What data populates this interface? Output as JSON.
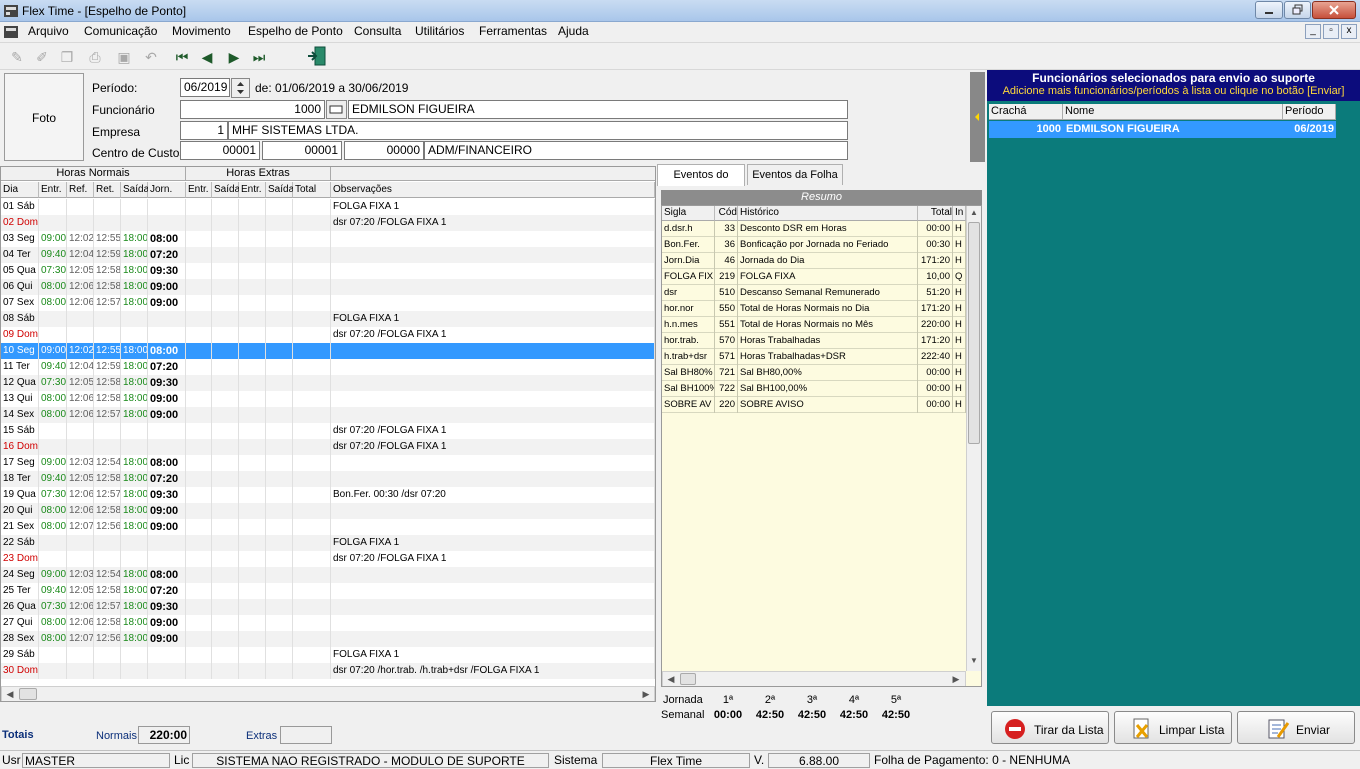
{
  "window": {
    "title": "Flex Time - [Espelho de Ponto]",
    "min": "0",
    "max": "1",
    "close": "r"
  },
  "menu": [
    "Arquivo",
    "Comunicação",
    "Movimento",
    "Espelho de Ponto",
    "Consulta",
    "Utilitários",
    "Ferramentas",
    "Ajuda"
  ],
  "header": {
    "foto": "Foto",
    "periodo_label": "Período:",
    "periodo_value": "06/2019",
    "periodo_range": "de: 01/06/2019 a 30/06/2019",
    "funcionario_label": "Funcionário",
    "funcionario_code": "1000",
    "funcionario_name": "EDMILSON FIGUEIRA",
    "empresa_label": "Empresa",
    "empresa_code": "1",
    "empresa_name": "MHF SISTEMAS LTDA.",
    "cc_label": "Centro de Custos",
    "cc1": "00001",
    "cc2": "00001",
    "cc3": "00000",
    "cc_name": "ADM/FINANCEIRO"
  },
  "grid": {
    "group_normais": "Horas Normais",
    "group_extras": "Horas Extras",
    "columns": [
      "Dia",
      "Entr.",
      "Ref.",
      "Ret.",
      "Saída",
      "Jorn.",
      "Entr.",
      "Saída",
      "Entr.",
      "Saída",
      "Total",
      "Observações"
    ],
    "rows": [
      {
        "dia": "01 Sáb",
        "e": "",
        "r": "",
        "t": "",
        "s": "",
        "j": "",
        "obs": "FOLGA FIXA 1",
        "dom": false
      },
      {
        "dia": "02 Dom",
        "e": "",
        "r": "",
        "t": "",
        "s": "",
        "j": "",
        "obs": "dsr     07:20 /FOLGA FIXA 1",
        "dom": true
      },
      {
        "dia": "03 Seg",
        "e": "09:00",
        "r": "12:02",
        "t": "12:55",
        "s": "18:00",
        "j": "08:00",
        "obs": "",
        "dom": false
      },
      {
        "dia": "04 Ter",
        "e": "09:40",
        "r": "12:04",
        "t": "12:59",
        "s": "18:00",
        "j": "07:20",
        "obs": "",
        "dom": false
      },
      {
        "dia": "05 Qua",
        "e": "07:30",
        "r": "12:05",
        "t": "12:58",
        "s": "18:00",
        "j": "09:30",
        "obs": "",
        "dom": false
      },
      {
        "dia": "06 Qui",
        "e": "08:00",
        "r": "12:06",
        "t": "12:58",
        "s": "18:00",
        "j": "09:00",
        "obs": "",
        "dom": false
      },
      {
        "dia": "07 Sex",
        "e": "08:00",
        "r": "12:06",
        "t": "12:57",
        "s": "18:00",
        "j": "09:00",
        "obs": "",
        "dom": false
      },
      {
        "dia": "08 Sáb",
        "e": "",
        "r": "",
        "t": "",
        "s": "",
        "j": "",
        "obs": "FOLGA FIXA 1",
        "dom": false
      },
      {
        "dia": "09 Dom",
        "e": "",
        "r": "",
        "t": "",
        "s": "",
        "j": "",
        "obs": "dsr     07:20 /FOLGA FIXA 1",
        "dom": true
      },
      {
        "dia": "10 Seg",
        "e": "09:00",
        "r": "12:02",
        "t": "12:55",
        "s": "18:00",
        "j": "08:00",
        "obs": "",
        "dom": false,
        "sel": true
      },
      {
        "dia": "11 Ter",
        "e": "09:40",
        "r": "12:04",
        "t": "12:59",
        "s": "18:00",
        "j": "07:20",
        "obs": "",
        "dom": false
      },
      {
        "dia": "12 Qua",
        "e": "07:30",
        "r": "12:05",
        "t": "12:58",
        "s": "18:00",
        "j": "09:30",
        "obs": "",
        "dom": false
      },
      {
        "dia": "13 Qui",
        "e": "08:00",
        "r": "12:06",
        "t": "12:58",
        "s": "18:00",
        "j": "09:00",
        "obs": "",
        "dom": false
      },
      {
        "dia": "14 Sex",
        "e": "08:00",
        "r": "12:06",
        "t": "12:57",
        "s": "18:00",
        "j": "09:00",
        "obs": "",
        "dom": false
      },
      {
        "dia": "15 Sáb",
        "e": "",
        "r": "",
        "t": "",
        "s": "",
        "j": "",
        "obs": "dsr     07:20 /FOLGA FIXA 1",
        "dom": false
      },
      {
        "dia": "16 Dom",
        "e": "",
        "r": "",
        "t": "",
        "s": "",
        "j": "",
        "obs": "dsr     07:20 /FOLGA FIXA 1",
        "dom": true
      },
      {
        "dia": "17 Seg",
        "e": "09:00",
        "r": "12:03",
        "t": "12:54",
        "s": "18:00",
        "j": "08:00",
        "obs": "",
        "dom": false
      },
      {
        "dia": "18 Ter",
        "e": "09:40",
        "r": "12:05",
        "t": "12:58",
        "s": "18:00",
        "j": "07:20",
        "obs": "",
        "dom": false
      },
      {
        "dia": "19 Qua",
        "e": "07:30",
        "r": "12:06",
        "t": "12:57",
        "s": "18:00",
        "j": "09:30",
        "obs": "Bon.Fer. 00:30 /dsr      07:20",
        "dom": false
      },
      {
        "dia": "20 Qui",
        "e": "08:00",
        "r": "12:06",
        "t": "12:58",
        "s": "18:00",
        "j": "09:00",
        "obs": "",
        "dom": false
      },
      {
        "dia": "21 Sex",
        "e": "08:00",
        "r": "12:07",
        "t": "12:56",
        "s": "18:00",
        "j": "09:00",
        "obs": "",
        "dom": false
      },
      {
        "dia": "22 Sáb",
        "e": "",
        "r": "",
        "t": "",
        "s": "",
        "j": "",
        "obs": "FOLGA FIXA 1",
        "dom": false
      },
      {
        "dia": "23 Dom",
        "e": "",
        "r": "",
        "t": "",
        "s": "",
        "j": "",
        "obs": "dsr     07:20 /FOLGA FIXA 1",
        "dom": true
      },
      {
        "dia": "24 Seg",
        "e": "09:00",
        "r": "12:03",
        "t": "12:54",
        "s": "18:00",
        "j": "08:00",
        "obs": "",
        "dom": false
      },
      {
        "dia": "25 Ter",
        "e": "09:40",
        "r": "12:05",
        "t": "12:58",
        "s": "18:00",
        "j": "07:20",
        "obs": "",
        "dom": false
      },
      {
        "dia": "26 Qua",
        "e": "07:30",
        "r": "12:06",
        "t": "12:57",
        "s": "18:00",
        "j": "09:30",
        "obs": "",
        "dom": false
      },
      {
        "dia": "27 Qui",
        "e": "08:00",
        "r": "12:06",
        "t": "12:58",
        "s": "18:00",
        "j": "09:00",
        "obs": "",
        "dom": false
      },
      {
        "dia": "28 Sex",
        "e": "08:00",
        "r": "12:07",
        "t": "12:56",
        "s": "18:00",
        "j": "09:00",
        "obs": "",
        "dom": false
      },
      {
        "dia": "29 Sáb",
        "e": "",
        "r": "",
        "t": "",
        "s": "",
        "j": "",
        "obs": "FOLGA FIXA 1",
        "dom": false
      },
      {
        "dia": "30 Dom",
        "e": "",
        "r": "",
        "t": "",
        "s": "",
        "j": "",
        "obs": "dsr     07:20 /hor.trab. /h.trab+dsr /FOLGA FIXA 1",
        "dom": true
      }
    ]
  },
  "tabs": [
    "Eventos do Ponto",
    "Eventos da Folha"
  ],
  "resumo": {
    "title": "Resumo",
    "columns": [
      "Sigla",
      "Cód",
      "Histórico",
      "Total",
      "In"
    ],
    "rows": [
      [
        "d.dsr.h",
        "33",
        "Desconto DSR em Horas",
        "00:00",
        "H"
      ],
      [
        "Bon.Fer.",
        "36",
        "Bonficação por Jornada no Feriado",
        "00:30",
        "H"
      ],
      [
        "Jorn.Dia",
        "46",
        "Jornada do Dia",
        "171:20",
        "H"
      ],
      [
        "FOLGA FIX",
        "219",
        "FOLGA FIXA",
        "10,00",
        "Q"
      ],
      [
        "dsr",
        "510",
        "Descanso Semanal Remunerado",
        "51:20",
        "H"
      ],
      [
        "hor.nor",
        "550",
        "Total de Horas Normais no Dia",
        "171:20",
        "H"
      ],
      [
        "h.n.mes",
        "551",
        "Total de Horas Normais no Mês",
        "220:00",
        "H"
      ],
      [
        "hor.trab.",
        "570",
        "Horas Trabalhadas",
        "171:20",
        "H"
      ],
      [
        "h.trab+dsr",
        "571",
        "Horas Trabalhadas+DSR",
        "222:40",
        "H"
      ],
      [
        "Sal BH80%",
        "721",
        "Sal BH80,00%",
        "00:00",
        "H"
      ],
      [
        "Sal BH100%",
        "722",
        "Sal BH100,00%",
        "00:00",
        "H"
      ],
      [
        "SOBRE AV",
        "220",
        "SOBRE AVISO",
        "00:00",
        "H"
      ]
    ]
  },
  "jornada": {
    "label": "Jornada",
    "semanal_label": "Semanal",
    "weeks": [
      "1ª",
      "2ª",
      "3ª",
      "4ª",
      "5ª"
    ],
    "values": [
      "00:00",
      "42:50",
      "42:50",
      "42:50",
      "42:50"
    ]
  },
  "totais": {
    "label": "Totais",
    "normais_label": "Normais",
    "normais_value": "220:00",
    "extras_label": "Extras",
    "extras_value": ""
  },
  "status": {
    "usr_label": "Usr",
    "usr": "MASTER",
    "lic_label": "Lic",
    "lic": "SISTEMA NAO REGISTRADO - MODULO DE SUPORTE",
    "sistema_label": "Sistema",
    "sistema": "Flex Time",
    "versao_label": "V.",
    "versao": "6.88.00",
    "folha": "Folha de Pagamento: 0 - NENHUMA"
  },
  "panel": {
    "title": "Funcionários selecionados para envio ao suporte",
    "subtitle": "Adicione mais funcionários/períodos à lista ou clique no botão [Enviar]",
    "columns": [
      "Crachá",
      "Nome",
      "Período"
    ],
    "row": {
      "cracha": "1000",
      "nome": "EDMILSON FIGUEIRA",
      "periodo": "06/2019"
    },
    "btn_tirar": "Tirar da Lista",
    "btn_limpar": "Limpar Lista",
    "btn_enviar": "Enviar"
  },
  "colors": {
    "selection": "#3399ff",
    "panel_bg": "#0b7b7b",
    "panel_head": "#0c0c7c",
    "resumo_bg": "#fdfbe0",
    "sunday": "#d00000",
    "entry_green": "#1a8a1a"
  }
}
